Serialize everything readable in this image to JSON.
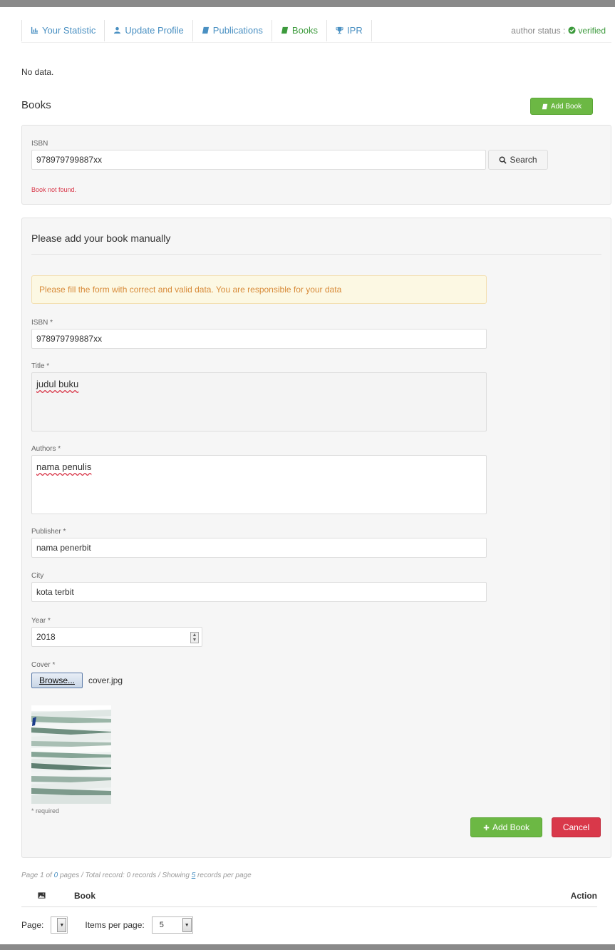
{
  "nav": {
    "items": [
      {
        "label": "Your Statistic",
        "icon": "bar-chart-icon"
      },
      {
        "label": "Update Profile",
        "icon": "user-icon"
      },
      {
        "label": "Publications",
        "icon": "book-icon"
      },
      {
        "label": "Books",
        "icon": "book-icon"
      },
      {
        "label": "IPR",
        "icon": "trophy-icon"
      }
    ],
    "status_label": "author status :",
    "status_value": "verified"
  },
  "no_data": "No data.",
  "books_title": "Books",
  "add_book_top": "Add Book",
  "search": {
    "label": "ISBN",
    "value": "978979799887xx",
    "button": "Search",
    "error": "Book not found."
  },
  "form": {
    "title": "Please add your book manually",
    "alert": "Please fill the form with correct and valid data. You are responsible for your data",
    "isbn_label": "ISBN *",
    "isbn_value": "978979799887xx",
    "title_label": "Title *",
    "title_value": "judul buku",
    "authors_label": "Authors *",
    "authors_value": "nama penulis",
    "publisher_label": "Publisher *",
    "publisher_value": "nama penerbit",
    "city_label": "City",
    "city_value": "kota terbit",
    "year_label": "Year *",
    "year_value": "2018",
    "cover_label": "Cover *",
    "browse_label": "Browse...",
    "file_name": "cover.jpg",
    "required_note": "* required",
    "add_button": "Add Book",
    "cancel_button": "Cancel"
  },
  "pager_info": {
    "prefix": "Page",
    "page": "1",
    "of": "of",
    "total_pages": "0",
    "middle": "pages / Total record:",
    "records": "0",
    "records_suffix": "records / Showing",
    "per_page": "5",
    "suffix": "records per page"
  },
  "table": {
    "col_book": "Book",
    "col_action": "Action"
  },
  "pager": {
    "page_label": "Page:",
    "items_label": "Items per page:",
    "items_value": "5"
  },
  "colors": {
    "accent_green": "#6cb844",
    "danger_red": "#d9384a",
    "link_blue": "#4a90c2"
  }
}
